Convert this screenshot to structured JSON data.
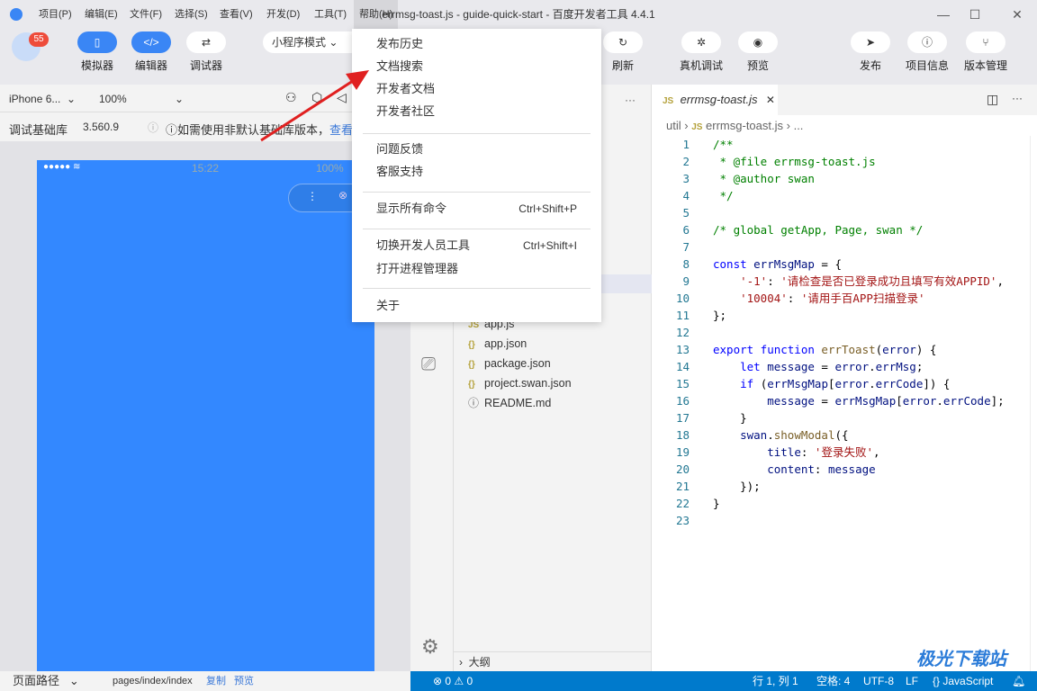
{
  "window": {
    "title": "errmsg-toast.js - guide-quick-start - 百度开发者工具 4.4.1",
    "minimize": "—",
    "maximize": "☐",
    "close": "✕"
  },
  "menubar": [
    "项目(P)",
    "编辑(E)",
    "文件(F)",
    "选择(S)",
    "查看(V)",
    "开发(D)",
    "工具(T)",
    "帮助(H)"
  ],
  "toolbar": {
    "badge": "55",
    "simulator": "模拟器",
    "editor": "编辑器",
    "debugger": "调试器",
    "mode": "小程序模式",
    "refresh": "刷新",
    "real_debug": "真机调试",
    "preview": "预览",
    "publish": "发布",
    "project_info": "项目信息",
    "version_mgmt": "版本管理"
  },
  "help_menu": {
    "items": [
      {
        "label": "发布历史"
      },
      {
        "label": "文档搜索"
      },
      {
        "label": "开发者文档"
      },
      {
        "label": "开发者社区"
      },
      {
        "label": "问题反馈"
      },
      {
        "label": "客服支持"
      },
      {
        "label": "显示所有命令",
        "shortcut": "Ctrl+Shift+P"
      },
      {
        "label": "切换开发人员工具",
        "shortcut": "Ctrl+Shift+I"
      },
      {
        "label": "打开进程管理器"
      },
      {
        "label": "关于"
      }
    ]
  },
  "simulator": {
    "device": "iPhone 6...",
    "zoom": "100%",
    "lib_label": "调试基础库",
    "lib_version": "3.560.9",
    "notice": "如需使用非默认基础库版本，",
    "notice_link": "查看",
    "time": "15:22",
    "battery": "100%",
    "accent": "#3388ff"
  },
  "explorer": {
    "files": [
      {
        "name": "app.js",
        "icon": "JS"
      },
      {
        "name": "app.json",
        "icon": "{}"
      },
      {
        "name": "package.json",
        "icon": "{}"
      },
      {
        "name": "project.swan.json",
        "icon": "{}"
      },
      {
        "name": "README.md",
        "icon": "ⓘ"
      }
    ],
    "outline": "大纲",
    "more": "···"
  },
  "editor": {
    "tab": "errmsg-toast.js",
    "breadcrumb": [
      "util",
      "errmsg-toast.js",
      "..."
    ],
    "lines": [
      [
        [
          "c",
          "/**"
        ]
      ],
      [
        [
          "c",
          " * @file errmsg-toast.js"
        ]
      ],
      [
        [
          "c",
          " * @author swan"
        ]
      ],
      [
        [
          "c",
          " */"
        ]
      ],
      [],
      [
        [
          "c",
          "/* global getApp, Page, swan */"
        ]
      ],
      [],
      [
        [
          "k",
          "const "
        ],
        [
          "v",
          "errMsgMap"
        ],
        [
          "p",
          " = {"
        ]
      ],
      [
        [
          "p",
          "    "
        ],
        [
          "s",
          "'-1'"
        ],
        [
          "p",
          ": "
        ],
        [
          "s",
          "'请检查是否已登录成功且填写有效APPID'"
        ],
        [
          "p",
          ","
        ]
      ],
      [
        [
          "p",
          "    "
        ],
        [
          "s",
          "'10004'"
        ],
        [
          "p",
          ": "
        ],
        [
          "s",
          "'请用手百APP扫描登录'"
        ]
      ],
      [
        [
          "p",
          "};"
        ]
      ],
      [],
      [
        [
          "k",
          "export function "
        ],
        [
          "f",
          "errToast"
        ],
        [
          "p",
          "("
        ],
        [
          "v",
          "error"
        ],
        [
          "p",
          ") {"
        ]
      ],
      [
        [
          "p",
          "    "
        ],
        [
          "k",
          "let "
        ],
        [
          "v",
          "message"
        ],
        [
          "p",
          " = "
        ],
        [
          "v",
          "error"
        ],
        [
          "p",
          "."
        ],
        [
          "v",
          "errMsg"
        ],
        [
          "p",
          ";"
        ]
      ],
      [
        [
          "p",
          "    "
        ],
        [
          "k",
          "if"
        ],
        [
          "p",
          " ("
        ],
        [
          "v",
          "errMsgMap"
        ],
        [
          "p",
          "["
        ],
        [
          "v",
          "error"
        ],
        [
          "p",
          "."
        ],
        [
          "v",
          "errCode"
        ],
        [
          "p",
          "]) {"
        ]
      ],
      [
        [
          "p",
          "        "
        ],
        [
          "v",
          "message"
        ],
        [
          "p",
          " = "
        ],
        [
          "v",
          "errMsgMap"
        ],
        [
          "p",
          "["
        ],
        [
          "v",
          "error"
        ],
        [
          "p",
          "."
        ],
        [
          "v",
          "errCode"
        ],
        [
          "p",
          "];"
        ]
      ],
      [
        [
          "p",
          "    }"
        ]
      ],
      [
        [
          "p",
          "    "
        ],
        [
          "v",
          "swan"
        ],
        [
          "p",
          "."
        ],
        [
          "f",
          "showModal"
        ],
        [
          "p",
          "({"
        ]
      ],
      [
        [
          "p",
          "        "
        ],
        [
          "v",
          "title"
        ],
        [
          "p",
          ": "
        ],
        [
          "s",
          "'登录失败'"
        ],
        [
          "p",
          ","
        ]
      ],
      [
        [
          "p",
          "        "
        ],
        [
          "v",
          "content"
        ],
        [
          "p",
          ": "
        ],
        [
          "v",
          "message"
        ]
      ],
      [
        [
          "p",
          "    });"
        ]
      ],
      [
        [
          "p",
          "}"
        ]
      ],
      []
    ]
  },
  "footer": {
    "page_path_label": "页面路径",
    "page_path": "pages/index/index",
    "copy": "复制",
    "preview": "预览"
  },
  "statusbar": {
    "errors": "0",
    "warnings": "0",
    "position": "行 1, 列 1",
    "spaces": "空格: 4",
    "encoding": "UTF-8",
    "eol": "LF",
    "language": "JavaScript",
    "color": "#007acc"
  },
  "watermark": "极光下载站"
}
